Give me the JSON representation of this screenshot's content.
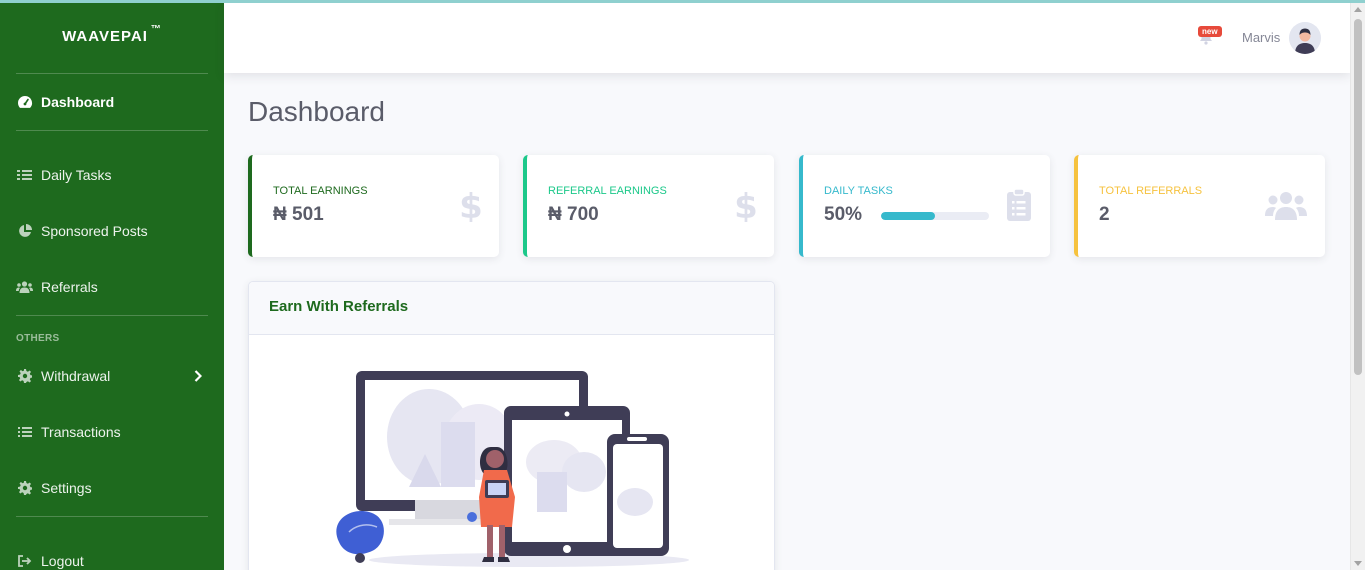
{
  "sidebar": {
    "brand": "WAAVEPAI",
    "brand_mark": "TM",
    "items_main": [
      {
        "label": "Dashboard",
        "icon": "tachometer-icon"
      },
      {
        "label": "Daily Tasks",
        "icon": "tasks-icon"
      },
      {
        "label": "Sponsored Posts",
        "icon": "chart-icon"
      },
      {
        "label": "Referrals",
        "icon": "users-icon"
      }
    ],
    "heading_others": "OTHERS",
    "items_others": [
      {
        "label": "Withdrawal",
        "icon": "gear-icon"
      },
      {
        "label": "Transactions",
        "icon": "list-icon"
      },
      {
        "label": "Settings",
        "icon": "gear-icon"
      }
    ],
    "logout_label": "Logout"
  },
  "topbar": {
    "badge": "new",
    "username": "Marvis"
  },
  "main": {
    "title": "Dashboard",
    "cards": [
      {
        "label": "TOTAL EARNINGS",
        "value": "₦ 501",
        "accent": "#1e6a1e",
        "label_color": "#1e6a1e",
        "icon": "dollar-icon"
      },
      {
        "label": "REFERRAL EARNINGS",
        "value": "₦ 700",
        "accent": "#1cc88a",
        "label_color": "#1cc88a",
        "icon": "dollar-icon"
      },
      {
        "label": "DAILY TASKS",
        "value": "50%",
        "accent": "#36b9cc",
        "label_color": "#36b9cc",
        "icon": "clipboard-icon",
        "progress": 0.5
      },
      {
        "label": "TOTAL REFERRALS",
        "value": "2",
        "accent": "#f6c23e",
        "label_color": "#f6c23e",
        "icon": "users-icon"
      }
    ],
    "earn_panel": {
      "title": "Earn With Referrals"
    }
  },
  "colors": {
    "sidebar_bg": "#1e6a1e",
    "primary": "#1e6a1e",
    "success": "#1cc88a",
    "info": "#36b9cc",
    "warning": "#f6c23e"
  }
}
